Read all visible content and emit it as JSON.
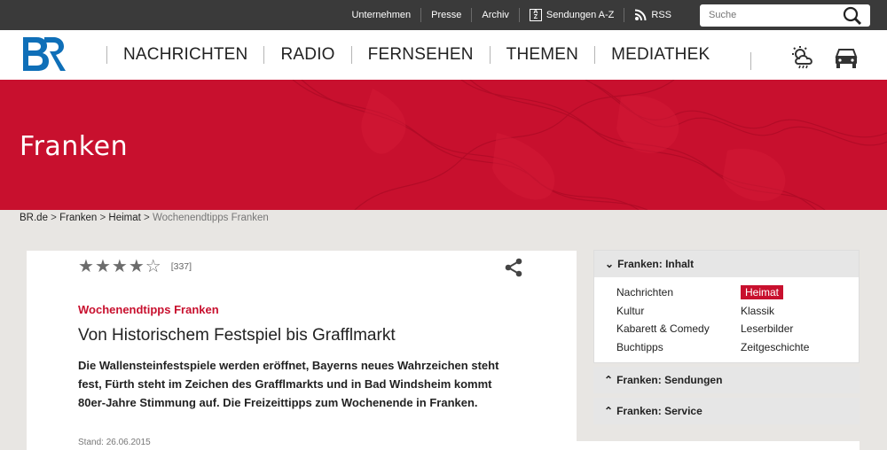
{
  "topbar": {
    "links": [
      "Unternehmen",
      "Presse",
      "Archiv",
      "Sendungen A-Z",
      "RSS"
    ],
    "search_placeholder": "Suche"
  },
  "nav": {
    "items": [
      "NACHRICHTEN",
      "RADIO",
      "FERNSEHEN",
      "THEMEN",
      "MEDIATHEK"
    ],
    "icons": [
      "weather-icon",
      "traffic-icon"
    ]
  },
  "banner": {
    "title": "Franken"
  },
  "breadcrumb": [
    "BR.de",
    "Franken",
    "Heimat",
    "Wochenendtipps Franken"
  ],
  "article": {
    "rating": {
      "value": 4,
      "max": 5,
      "count": "[337]"
    },
    "kicker": "Wochenendtipps Franken",
    "headline": "Von Historischem Festspiel bis Grafflmarkt",
    "lead": "Die Wallensteinfestspiele werden eröffnet, Bayerns neues Wahrzeichen steht fest, Fürth steht im Zeichen des Grafflmarkts und in Bad Windsheim kommt 80er-Jahre Stimmung auf. Die Freizeittipps zum Wochenende in Franken.",
    "stand": "Stand: 26.06.2015"
  },
  "sidebar": {
    "inhalt": {
      "title": "Franken: Inhalt",
      "col1": [
        "Nachrichten",
        "Kultur",
        "Kabarett & Comedy",
        "Buchtipps"
      ],
      "col2": [
        "Heimat",
        "Klassik",
        "Leserbilder",
        "Zeitgeschichte"
      ],
      "active": "Heimat"
    },
    "sendungen": {
      "title": "Franken: Sendungen"
    },
    "service": {
      "title": "Franken: Service"
    }
  },
  "colors": {
    "brand_red": "#c8102e",
    "topbar": "#3a3a3a",
    "logo_blue": "#0f6fb8"
  }
}
